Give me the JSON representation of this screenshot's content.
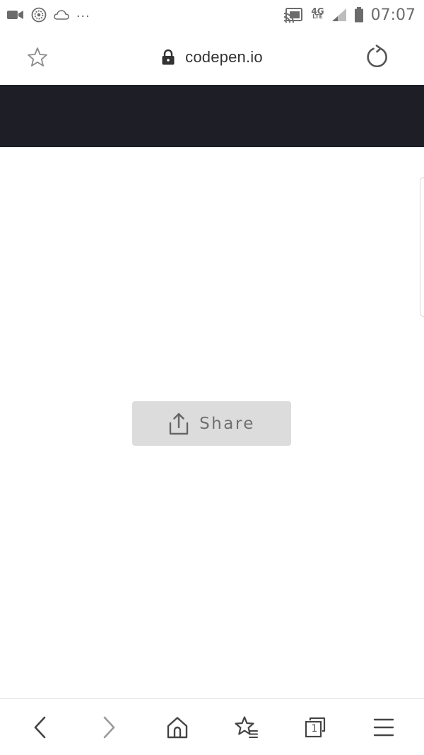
{
  "status_bar": {
    "time": "07:07",
    "dots": "...",
    "network": "4G",
    "network_sub": "LTE",
    "icons": [
      "video-icon",
      "circle-app-icon",
      "cloud-icon",
      "cast-icon",
      "signal-icon",
      "battery-icon"
    ]
  },
  "url_bar": {
    "url": "codepen.io",
    "icons": [
      "star-icon",
      "lock-icon",
      "reload-icon"
    ]
  },
  "page": {
    "header_color": "#1e1f26",
    "share_label": "Share"
  },
  "bottom_nav": {
    "tab_count": "1",
    "icons": [
      "back-arrow-icon",
      "forward-arrow-icon",
      "home-icon",
      "bookmarks-icon",
      "tabs-icon",
      "menu-icon"
    ]
  }
}
